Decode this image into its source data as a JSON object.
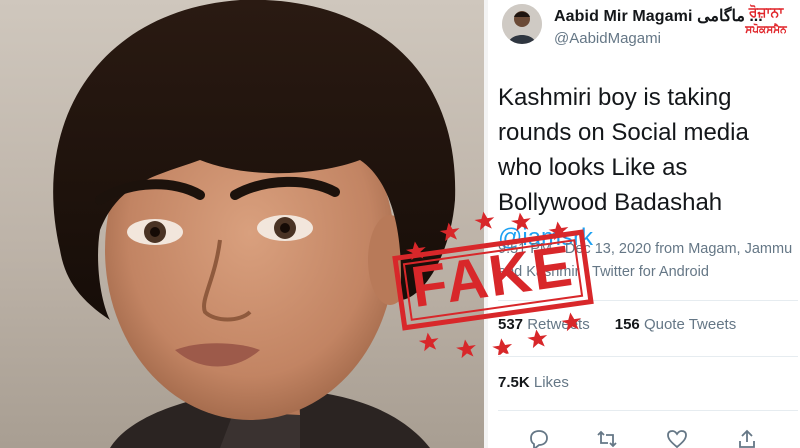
{
  "tweet": {
    "display_name": "Aabid Mir Magami",
    "display_name_urdu": "ماگامی",
    "handle": "@AabidMagami",
    "caret": "...",
    "text_main": "Kashmiri boy is taking rounds on Social media who looks Like as Bollywood Badashah ",
    "text_mention": "@iamsrk",
    "meta": "9:51 PM · Dec 13, 2020 from Magam, Jammu and Kashmir · Twitter for Android",
    "retweets_count": "537",
    "retweets_label": " Retweets",
    "quote_count": "156",
    "quote_label": " Quote Tweets",
    "likes_count": "7.5K",
    "likes_label": " Likes",
    "actions": [
      "reply-icon",
      "retweet-icon",
      "like-icon",
      "share-icon"
    ]
  },
  "logo": {
    "line1": "ਰੋਜ਼ਾਨਾ",
    "line2": "ਸਪੋਕਸਮੈਨ"
  },
  "stamp": {
    "word": "FAKE"
  },
  "colors": {
    "stamp_red": "#d8272a",
    "twitter_blue": "#1da1f2",
    "text_dark": "#14171a",
    "text_gray": "#657786"
  }
}
